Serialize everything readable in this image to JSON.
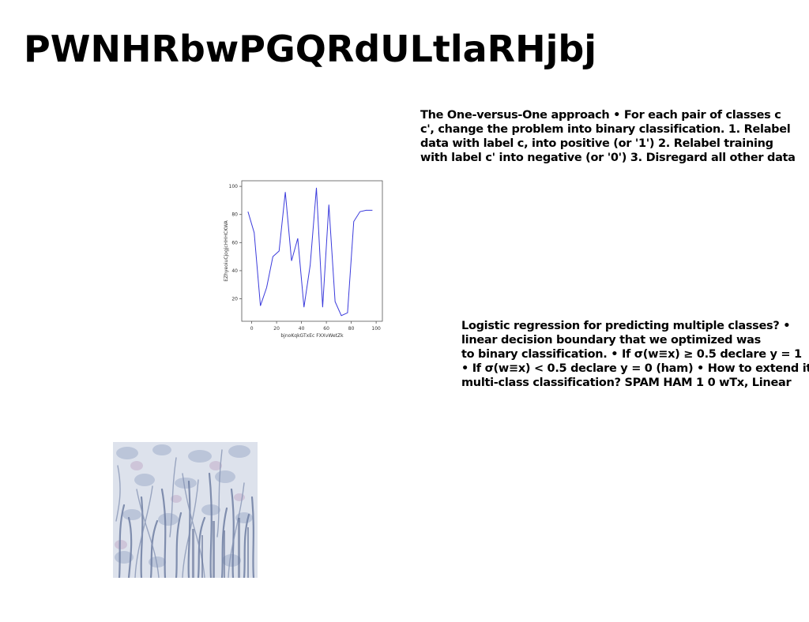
{
  "slide": {
    "title": "PWNHRbwPGQRdULtlaRHjbj",
    "text_block_1_lines": [
      "The One-versus-One approach • For each pair of classes c",
      "c', change the problem into binary classification. 1. Relabel",
      "data with label c, into positive (or '1') 2. Relabel training",
      "with label c' into negative (or '0') 3. Disregard all other data"
    ],
    "text_block_2_lines": [
      "Logistic regression for predicting multiple classes? •",
      "linear decision boundary that we optimized was",
      "to binary classification. • If σ(w≡x) ≥ 0.5 declare y = 1",
      "• If σ(w≡x) < 0.5 declare y = 0 (ham) • How to extend it",
      "multi-class classification? SPAM HAM 1 0 wTx, Linear"
    ]
  },
  "chart_data": {
    "type": "line",
    "x": [
      -3,
      2,
      7,
      12,
      17,
      22,
      27,
      32,
      37,
      42,
      47,
      52,
      57,
      62,
      67,
      72,
      77,
      82,
      87,
      92,
      97
    ],
    "y": [
      82,
      67,
      15,
      28,
      50,
      54,
      96,
      47,
      63,
      14,
      44,
      99,
      14,
      87,
      18,
      8,
      10,
      75,
      82,
      83,
      83
    ],
    "xlabel": "bjnoKqkGTxEc FXXvWetZk",
    "ylabel": "EZhyeoiuCjogjcHHHCKWA",
    "xlim": [
      -8,
      105
    ],
    "ylim": [
      4,
      104
    ],
    "xticks": [
      0,
      20,
      40,
      60,
      80,
      100
    ],
    "yticks": [
      20,
      40,
      60,
      80,
      100
    ],
    "series_color": "#3b3bdc",
    "grid": false
  },
  "colors": {
    "line": "#3b3bdc",
    "axis": "#555555"
  }
}
